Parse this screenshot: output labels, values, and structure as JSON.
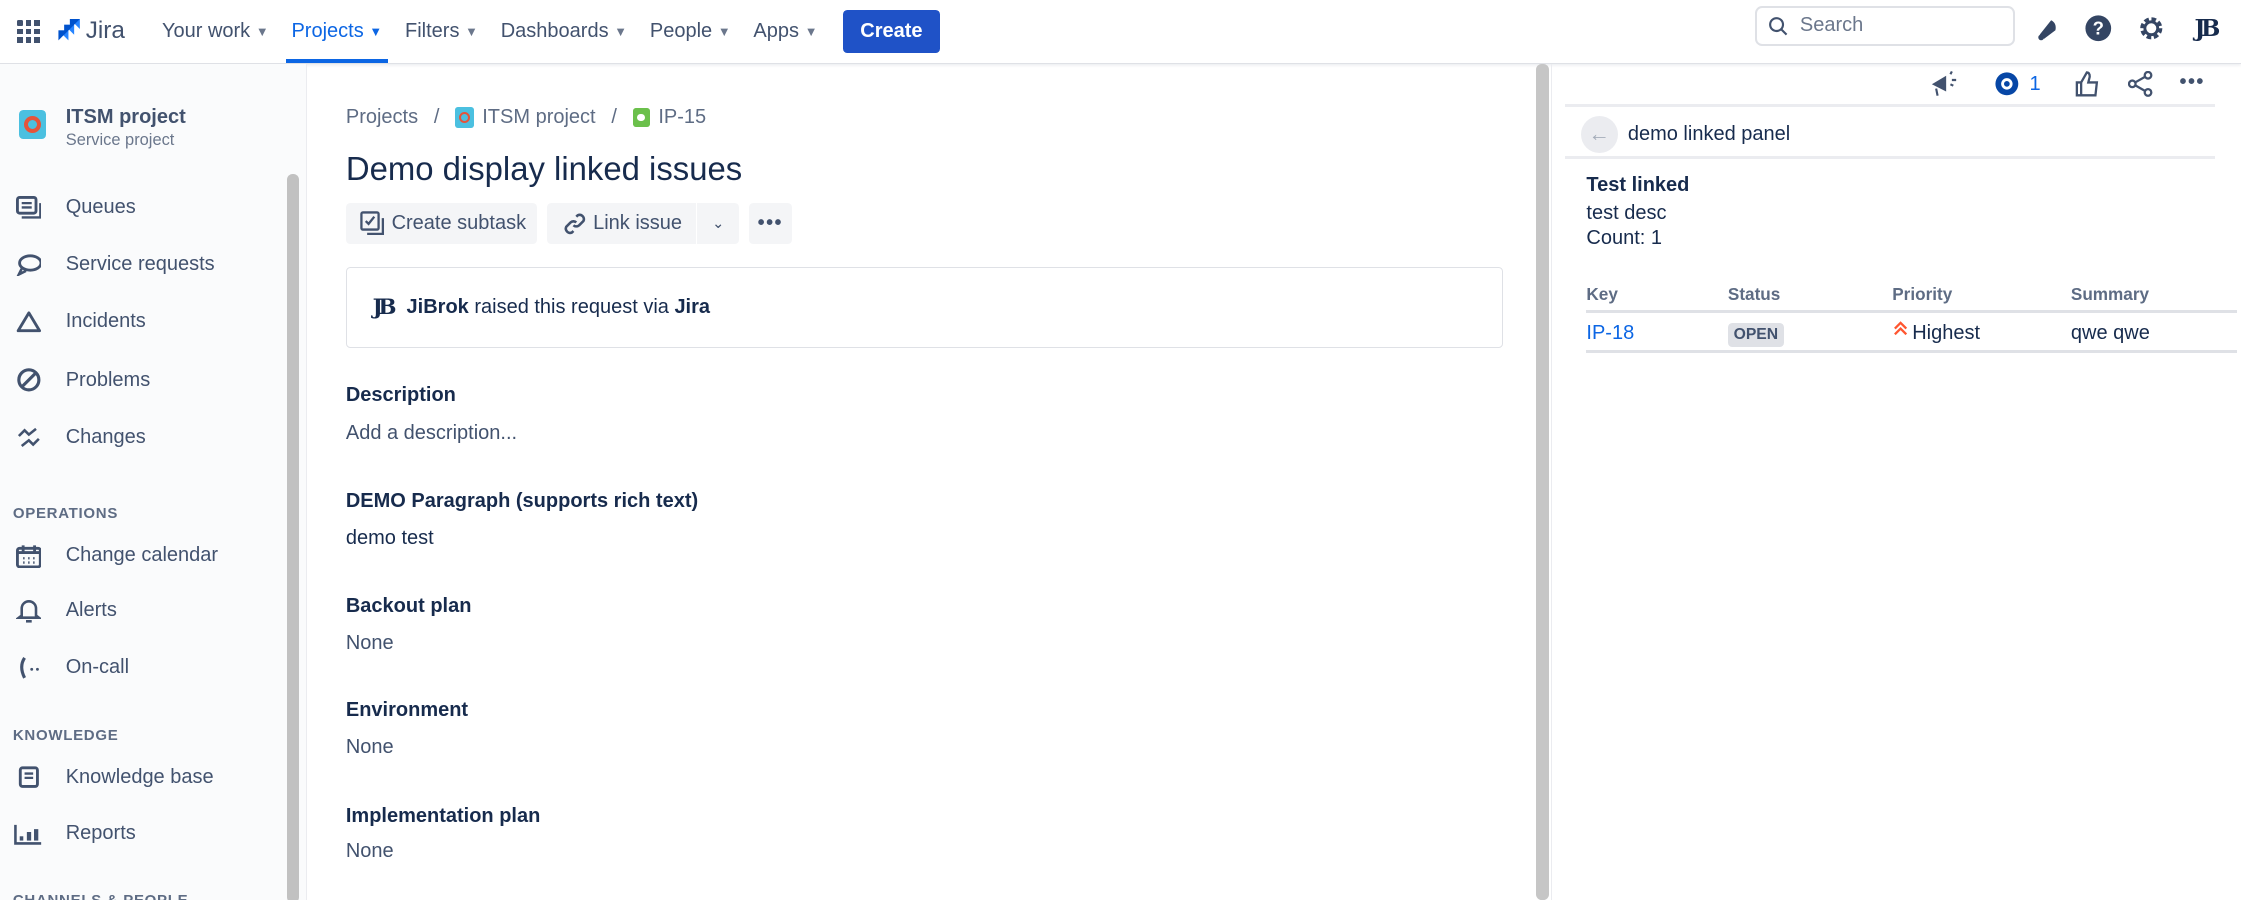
{
  "header": {
    "logo_text": "Jira",
    "nav": [
      {
        "label": "Your work"
      },
      {
        "label": "Projects",
        "active": true
      },
      {
        "label": "Filters"
      },
      {
        "label": "Dashboards"
      },
      {
        "label": "People"
      },
      {
        "label": "Apps"
      }
    ],
    "create_label": "Create",
    "search_placeholder": "Search",
    "avatar_initials": "JB"
  },
  "sidebar": {
    "project_name": "ITSM project",
    "project_type": "Service project",
    "items": [
      {
        "label": "Queues"
      },
      {
        "label": "Service requests"
      },
      {
        "label": "Incidents"
      },
      {
        "label": "Problems"
      },
      {
        "label": "Changes"
      }
    ],
    "sections": [
      {
        "title": "OPERATIONS",
        "items": [
          {
            "label": "Change calendar"
          },
          {
            "label": "Alerts"
          },
          {
            "label": "On-call"
          }
        ]
      },
      {
        "title": "KNOWLEDGE",
        "items": [
          {
            "label": "Knowledge base"
          },
          {
            "label": "Reports"
          }
        ]
      },
      {
        "title": "CHANNELS & PEOPLE",
        "items": []
      }
    ]
  },
  "issue": {
    "breadcrumb": [
      "Projects",
      "ITSM project",
      "IP-15"
    ],
    "title": "Demo display linked issues",
    "actions": {
      "create_subtask": "Create subtask",
      "link_issue": "Link issue"
    },
    "request": {
      "user": "JiBrok",
      "middle": " raised this request via ",
      "channel": "Jira"
    },
    "fields": [
      {
        "label": "Description",
        "value": "Add a description..."
      },
      {
        "label": "DEMO Paragraph (supports rich text)",
        "value": "demo test"
      },
      {
        "label": "Backout plan",
        "value": "None"
      },
      {
        "label": "Environment",
        "value": "None"
      },
      {
        "label": "Implementation plan",
        "value": "None"
      }
    ]
  },
  "panel": {
    "watch_count": "1",
    "title": "demo linked panel",
    "heading": "Test linked",
    "description": "test desc",
    "count_text": "Count: 1",
    "columns": [
      "Key",
      "Status",
      "Priority",
      "Summary"
    ],
    "rows": [
      {
        "key": "IP-18",
        "status": "OPEN",
        "priority": "Highest",
        "summary": "qwe qwe"
      }
    ],
    "colors": {
      "link": "#0c66e4",
      "priority_highest": "#ff5630"
    }
  }
}
